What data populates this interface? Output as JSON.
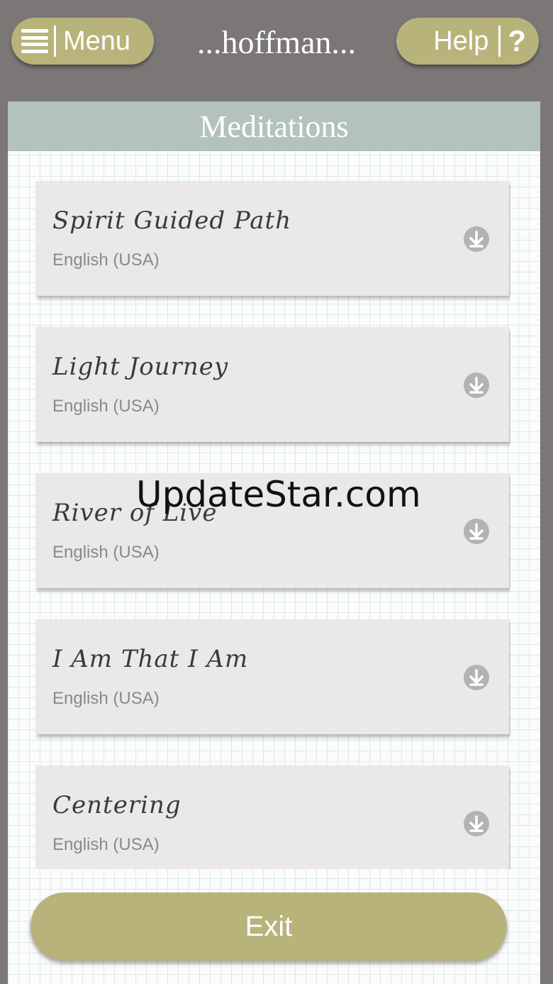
{
  "header": {
    "menu_label": "Menu",
    "title": "...hoffman...",
    "help_label": "Help",
    "help_glyph": "?"
  },
  "panel": {
    "title": "Meditations"
  },
  "meditations": [
    {
      "title": "Spirit Guided Path",
      "language": "English (USA)"
    },
    {
      "title": "Light Journey",
      "language": "English (USA)"
    },
    {
      "title": "River of Live",
      "language": "English (USA)"
    },
    {
      "title": "I Am That I Am",
      "language": "English (USA)"
    },
    {
      "title": "Centering",
      "language": "English (USA)"
    }
  ],
  "footer": {
    "exit_label": "Exit"
  },
  "watermark": "UpdateStar.com",
  "icons": {
    "menu": "hamburger-icon",
    "help": "question-icon",
    "download": "download-icon"
  },
  "colors": {
    "accent": "#b7b37b",
    "header": "#b3c2bf",
    "background": "#7a7776",
    "card": "#ebe9e8"
  }
}
